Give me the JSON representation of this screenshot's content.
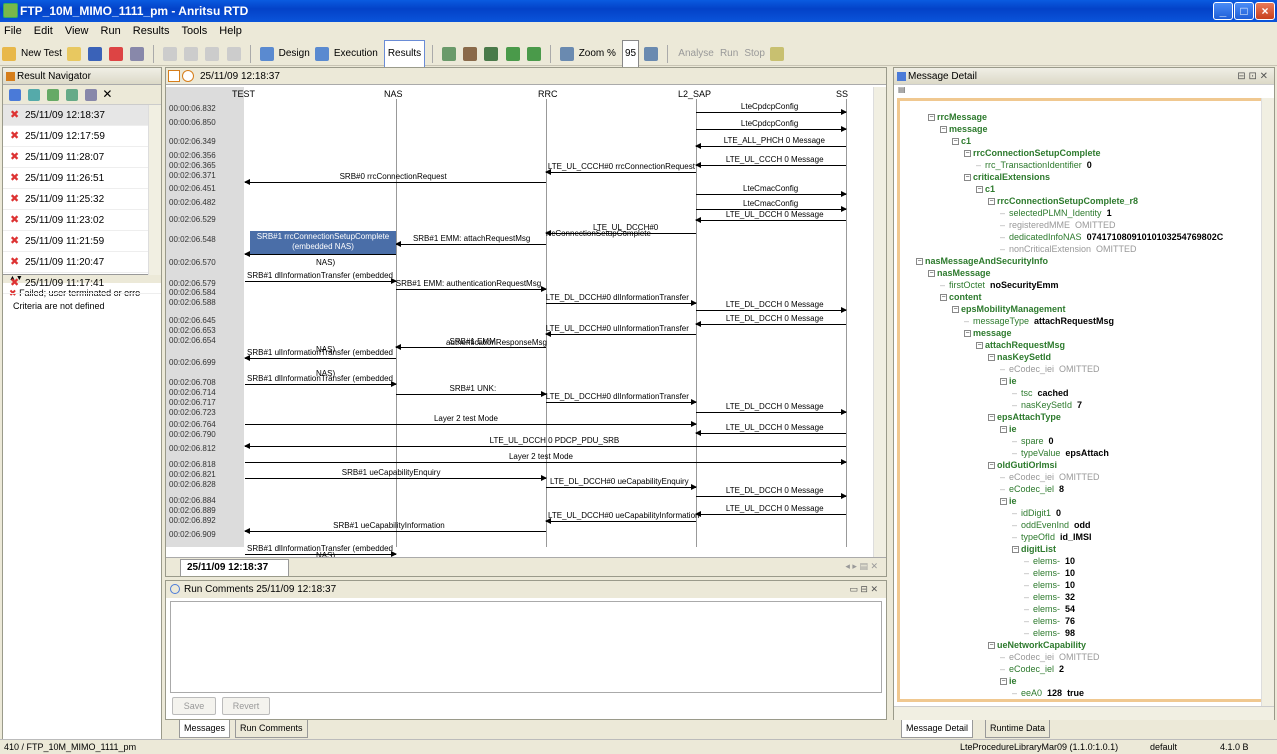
{
  "window": {
    "title": "FTP_10M_MIMO_1111_pm - Anritsu RTD"
  },
  "menu": [
    "File",
    "Edit",
    "View",
    "Run",
    "Results",
    "Tools",
    "Help"
  ],
  "toolbar": {
    "new_test": "New Test",
    "design": "Design",
    "execution": "Execution",
    "results": "Results",
    "zoom_label": "Zoom %",
    "zoom_value": "95",
    "analyse": "Analyse",
    "run": "Run",
    "stop": "Stop"
  },
  "navigator": {
    "title": "Result Navigator",
    "results": [
      "25/11/09 12:18:37",
      "25/11/09 12:17:59",
      "25/11/09 11:28:07",
      "25/11/09 11:26:51",
      "25/11/09 11:25:32",
      "25/11/09 11:23:02",
      "25/11/09 11:21:59",
      "25/11/09 11:20:47",
      "25/11/09 11:17:41"
    ],
    "detail_failed": "Failed; user terminated or erro",
    "detail_criteria": "Criteria are not defined"
  },
  "sequence": {
    "run_time": "25/11/09 12:18:37",
    "entities": [
      "TEST",
      "NAS",
      "RRC",
      "L2_SAP",
      "SS"
    ],
    "times": [
      "00:00:06.832",
      "00:00:06.850",
      "00:02:06.349",
      "00:02:06.356",
      "00:02:06.365",
      "00:02:06.371",
      "00:02:06.451",
      "00:02:06.482",
      "00:02:06.529",
      "00:02:06.548",
      "00:02:06.570",
      "00:02:06.579",
      "00:02:06.584",
      "00:02:06.588",
      "00:02:06.645",
      "00:02:06.653",
      "00:02:06.654",
      "00:02:06.699",
      "00:02:06.708",
      "00:02:06.714",
      "00:02:06.717",
      "00:02:06.723",
      "00:02:06.764",
      "00:02:06.790",
      "00:02:06.812",
      "00:02:06.818",
      "00:02:06.821",
      "00:02:06.828",
      "00:02:06.884",
      "00:02:06.889",
      "00:02:06.892",
      "00:02:06.909"
    ],
    "messages": [
      "LteCpdcpConfig",
      "LteCpdcpConfig",
      "LTE_ALL_PHCH 0 Message",
      "LTE_UL_CCCH 0 Message",
      "LTE_UL_CCCH#0 rrcConnectionRequest",
      "SRB#0 rrcConnectionRequest",
      "LteCmacConfig",
      "LteCmacConfig",
      "LTE_UL_DCCH 0 Message",
      "LTE_UL_DCCH#0",
      "rrcConnectionSetupComplete",
      "SRB#1 rrcConnectionSetupComplete",
      "(embedded NAS)",
      "SRB#1 EMM: attachRequestMsg",
      "SRB#1 dlInformationTransfer (embedded",
      "NAS)",
      "SRB#1 EMM: authenticationRequestMsg",
      "LTE_DL_DCCH#0 dlInformationTransfer",
      "LTE_DL_DCCH 0 Message",
      "LTE_DL_DCCH 0 Message",
      "LTE_UL_DCCH#0 ulInformationTransfer",
      "SRB#1 EMM:",
      "authenticationResponseMsg",
      "SRB#1 ulInformationTransfer (embedded",
      "NAS)",
      "SRB#1 dlInformationTransfer (embedded",
      "NAS)",
      "SRB#1 UNK:",
      "LTE_DL_DCCH#0 dlInformationTransfer",
      "LTE_DL_DCCH 0 Message",
      "Layer 2 test Mode",
      "LTE_UL_DCCH 0 Message",
      "LTE_UL_DCCH 0 PDCP_PDU_SRB",
      "Layer 2 test Mode",
      "SRB#1 ueCapabilityEnquiry",
      "LTE_DL_DCCH#0 ueCapabilityEnquiry",
      "LTE_DL_DCCH 0 Message",
      "LTE_UL_DCCH 0 Message",
      "LTE_UL_DCCH#0 ueCapabilityInformation",
      "SRB#1 ueCapabilityInformation",
      "SRB#1 dlInformationTransfer (embedded",
      "NAS)"
    ],
    "tab_label": "25/11/09 12:18:37"
  },
  "comments": {
    "title": "Run Comments 25/11/09 12:18:37",
    "save": "Save",
    "revert": "Revert"
  },
  "bottom_tabs": {
    "messages": "Messages",
    "run_comments": "Run Comments"
  },
  "detail": {
    "title": "Message Detail",
    "tree": [
      "rrcMessage",
      "message",
      "c1",
      "rrcConnectionSetupComplete",
      "rrc_TransactionIdentifier",
      "0",
      "criticalExtensions",
      "c1",
      "rrcConnectionSetupComplete_r8",
      "selectedPLMN_Identity",
      "1",
      "registeredMME",
      "OMITTED",
      "dedicatedInfoNAS",
      "0741710809101010325476980​2C",
      "nonCriticalExtension",
      "OMITTED",
      "nasMessageAndSecurityInfo",
      "nasMessage",
      "firstOctet",
      "noSecurityEmm",
      "content",
      "epsMobilityManagement",
      "messageType",
      "attachRequestMsg",
      "message",
      "attachRequestMsg",
      "nasKeySetId",
      "eCodec_iei",
      "OMITTED",
      "ie",
      "tsc",
      "cached",
      "nasKeySetId",
      "7",
      "epsAttachType",
      "ie",
      "spare",
      "0",
      "typeValue",
      "epsAttach",
      "oldGutiOrImsi",
      "eCodec_iei",
      "OMITTED",
      "eCodec_iel",
      "8",
      "ie",
      "idDigit1",
      "0",
      "oddEvenInd",
      "odd",
      "typeOfId",
      "id_IMSI",
      "digitList",
      "elems-",
      "10",
      "elems-",
      "10",
      "elems-",
      "10",
      "elems-",
      "32",
      "elems-",
      "54",
      "elems-",
      "76",
      "elems-",
      "98",
      "ueNetworkCapability",
      "eCodec_iei",
      "OMITTED",
      "eCodec_iel",
      "2",
      "ie",
      "eeA0",
      "128",
      "true"
    ],
    "tabs": [
      "Message Detail",
      "Runtime Data"
    ]
  },
  "status": {
    "left": "410 / FTP_10M_MIMO_1111_pm",
    "library": "LteProcedureLibraryMar09 (1.1.0:1.0.1)",
    "profile": "default",
    "version": "4.1.0 B"
  }
}
